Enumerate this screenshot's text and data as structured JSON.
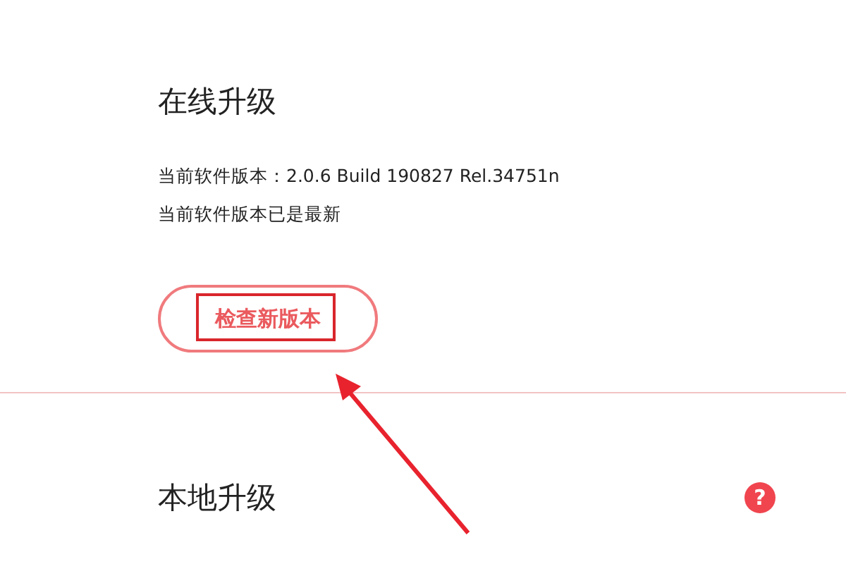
{
  "online_upgrade": {
    "title": "在线升级",
    "version_line": "当前软件版本：2.0.6 Build 190827 Rel.34751n",
    "status_line": "当前软件版本已是最新",
    "check_button": "检查新版本"
  },
  "local_upgrade": {
    "title": "本地升级",
    "help": "?"
  }
}
